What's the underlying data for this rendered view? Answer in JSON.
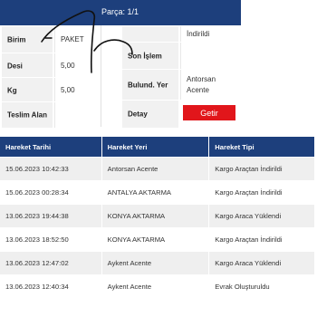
{
  "header": {
    "title": "Parça: 1/1"
  },
  "left_details": [
    {
      "label": "Birim",
      "value": "PAKET"
    },
    {
      "label": "Desi",
      "value": "5,00"
    },
    {
      "label": "Kg",
      "value": "5,00"
    },
    {
      "label": "Teslim Alan",
      "value": ""
    }
  ],
  "right_details": [
    {
      "label": "",
      "value": "İndirildi"
    },
    {
      "label": "Son İşlem",
      "value": ""
    },
    {
      "label": "Bulund. Yer",
      "value": "Antorsan Acente"
    },
    {
      "label": "Detay",
      "value": ""
    }
  ],
  "detail_button": {
    "label": "Getir"
  },
  "history": {
    "headers": [
      "Hareket Tarihi",
      "Hareket Yeri",
      "Hareket Tipi"
    ],
    "rows": [
      [
        "15.06.2023 10:42:33",
        "Antorsan Acente",
        "Kargo Araçtan İndirildi"
      ],
      [
        "15.06.2023 00:28:34",
        "ANTALYA AKTARMA",
        "Kargo Araçtan İndirildi"
      ],
      [
        "13.06.2023 19:44:38",
        "KONYA AKTARMA",
        "Kargo Araca Yüklendi"
      ],
      [
        "13.06.2023 18:52:50",
        "KONYA AKTARMA",
        "Kargo Araçtan İndirildi"
      ],
      [
        "13.06.2023 12:47:02",
        "Aykent Acente",
        "Kargo Araca Yüklendi"
      ],
      [
        "13.06.2023 12:40:34",
        "Aykent Acente",
        "Evrak Oluşturuldu"
      ]
    ]
  },
  "colors": {
    "header_bg": "#1d3f7c",
    "button_bg": "#e1161b",
    "label_bg": "#f1f1f1",
    "row_alt": "#efefef",
    "scribble": "#111111"
  },
  "icons": {
    "annotation": "handwritten-scribble"
  }
}
